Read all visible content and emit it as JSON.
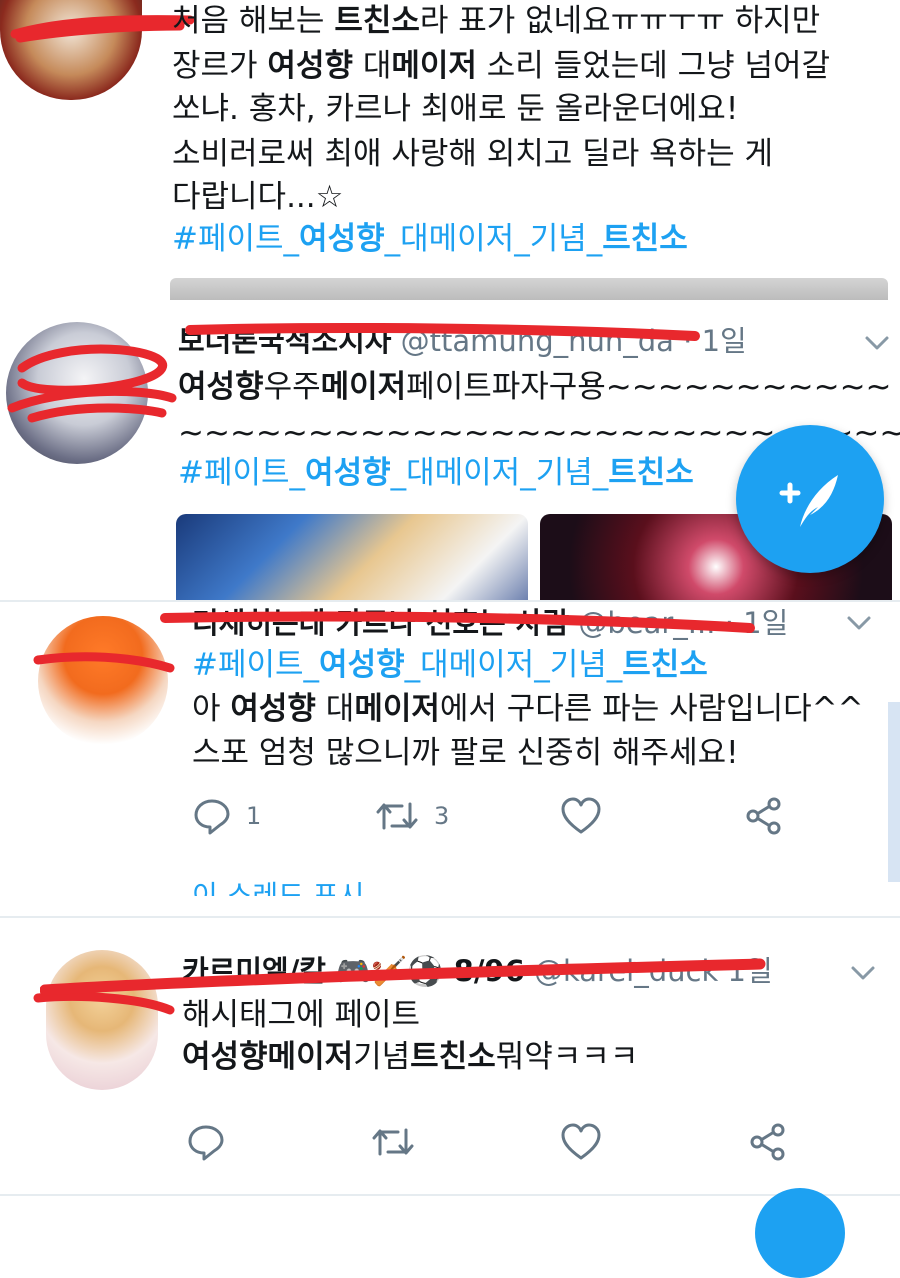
{
  "colors": {
    "accent": "#1da1f2",
    "text": "#14171a",
    "meta": "#657786",
    "redact": "#e8282d"
  },
  "tweets": [
    {
      "id": "t1",
      "lines": [
        [
          "처음 해보는 ",
          "트친소",
          "라 표가 없네요ㅠㅠㅜㅠ 하지만"
        ],
        [
          "장르가 ",
          "여성향",
          " 대",
          "메이저",
          " 소리 들었는데 그냥 넘어갈"
        ],
        [
          "쏘냐. 홍차, 카르나 최애로 둔 올라운더에요!"
        ],
        [
          "소비러로써 최애 사랑해 외치고 딜라 욕하는 게"
        ],
        [
          "다랍니다...☆"
        ]
      ],
      "hashtag": [
        "#페이트_",
        "여성향",
        "_대메이저_기념_",
        "트친소"
      ]
    },
    {
      "id": "t2",
      "name": "보더론국적소지자",
      "handle": "@ttamung_nun_da",
      "time": "· 1일",
      "body1": [
        "여성향",
        "우주",
        "메이저",
        "페이트파자구용~~~~~~~~~~~"
      ],
      "body2": "~~~~~~~~~~~~~~~~~~~~~~~~~~~~",
      "hashtag": [
        "#페이트_",
        "여성향",
        "_대메이저_기념_",
        "트친소"
      ]
    },
    {
      "id": "t3",
      "name": "리세히는데 카르나 선호는 사람",
      "handle": "@bear_...",
      "time": "· 1일",
      "hashtag": [
        "#페이트_",
        "여성향",
        "_대메이저_기념_",
        "트친소"
      ],
      "body1": [
        "아 ",
        "여성향",
        " 대",
        "메이저",
        "에서 구다른 파는 사람입니다^^"
      ],
      "body2": "스포 엄청 많으니까 팔로 신중히 해주세요!",
      "reply_count": "1",
      "retweet_count": "3",
      "show_thread": "이 스레드 표시"
    },
    {
      "id": "t4",
      "name": "카르미엘/칼",
      "name_emoji": "🎮🏏⚽ 8/96",
      "handle": "@karel_duck",
      "time": "1일",
      "body1": "해시태그에 페이트",
      "body2": [
        "여성향메이저",
        "기념",
        "트친소",
        "뭐약ㅋㅋㅋ"
      ]
    }
  ],
  "icons": [
    "reply-icon",
    "retweet-icon",
    "like-icon",
    "share-icon",
    "chevron-down-icon",
    "compose-tweet-icon"
  ]
}
